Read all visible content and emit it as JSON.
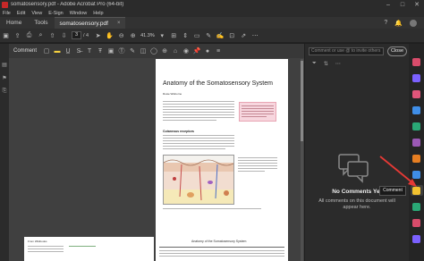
{
  "window": {
    "title": "somatosensory.pdf - Adobe Acrobat Pro (64-bit)",
    "minimize_glyph": "–",
    "maximize_glyph": "□",
    "close_glyph": "✕"
  },
  "menu": [
    "File",
    "Edit",
    "View",
    "E-Sign",
    "Window",
    "Help"
  ],
  "tabs": {
    "home": "Home",
    "tools": "Tools",
    "document": "somatosensory.pdf",
    "document_close": "×"
  },
  "toolbar": {
    "current_page": "3",
    "total_pages": "/ 4",
    "zoom": "41.3%"
  },
  "comment_bar": {
    "label": "Comment"
  },
  "document": {
    "page_title": "Anatomy of the Somatosensory System",
    "author": "Rosie Wisborne",
    "section_heading": "Cutaneous receptors",
    "page2_left_label": "From Wikibooks",
    "page2_right_title": "Anatomy of the Somatosensory System"
  },
  "comments_panel": {
    "search_placeholder": "Comment or use @ to invite others",
    "close_label": "Close",
    "empty_title": "No Comments Yet",
    "empty_description": "All comments on this document will appear here."
  },
  "tooltip": {
    "label": "Comment"
  },
  "colors": {
    "accent_blue": "#4aa3ff",
    "annotation_red": "#e53935",
    "highlight_yellow": "#f4d03f"
  }
}
